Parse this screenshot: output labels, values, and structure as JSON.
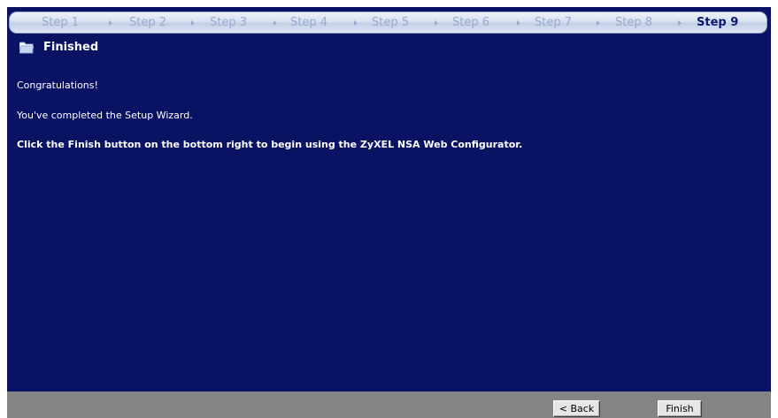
{
  "steps": [
    {
      "label": "Step 1"
    },
    {
      "label": "Step 2"
    },
    {
      "label": "Step 3"
    },
    {
      "label": "Step 4"
    },
    {
      "label": "Step 5"
    },
    {
      "label": "Step 6"
    },
    {
      "label": "Step 7"
    },
    {
      "label": "Step 8"
    },
    {
      "label": "Step 9"
    }
  ],
  "active_step": "Step 9",
  "header": {
    "title": "Finished",
    "icon": "folder-open-icon"
  },
  "content": {
    "line1": "Congratulations!",
    "line2": "You've completed the Setup Wizard.",
    "line3": "Click the Finish button on the bottom right to begin using the ZyXEL NSA Web Configurator."
  },
  "footer": {
    "back_label": "< Back",
    "finish_label": "Finish"
  },
  "colors": {
    "background": "#0a1264",
    "footer": "#848484",
    "step_inactive": "#9aaad0",
    "step_active": "#0a1a6e"
  }
}
